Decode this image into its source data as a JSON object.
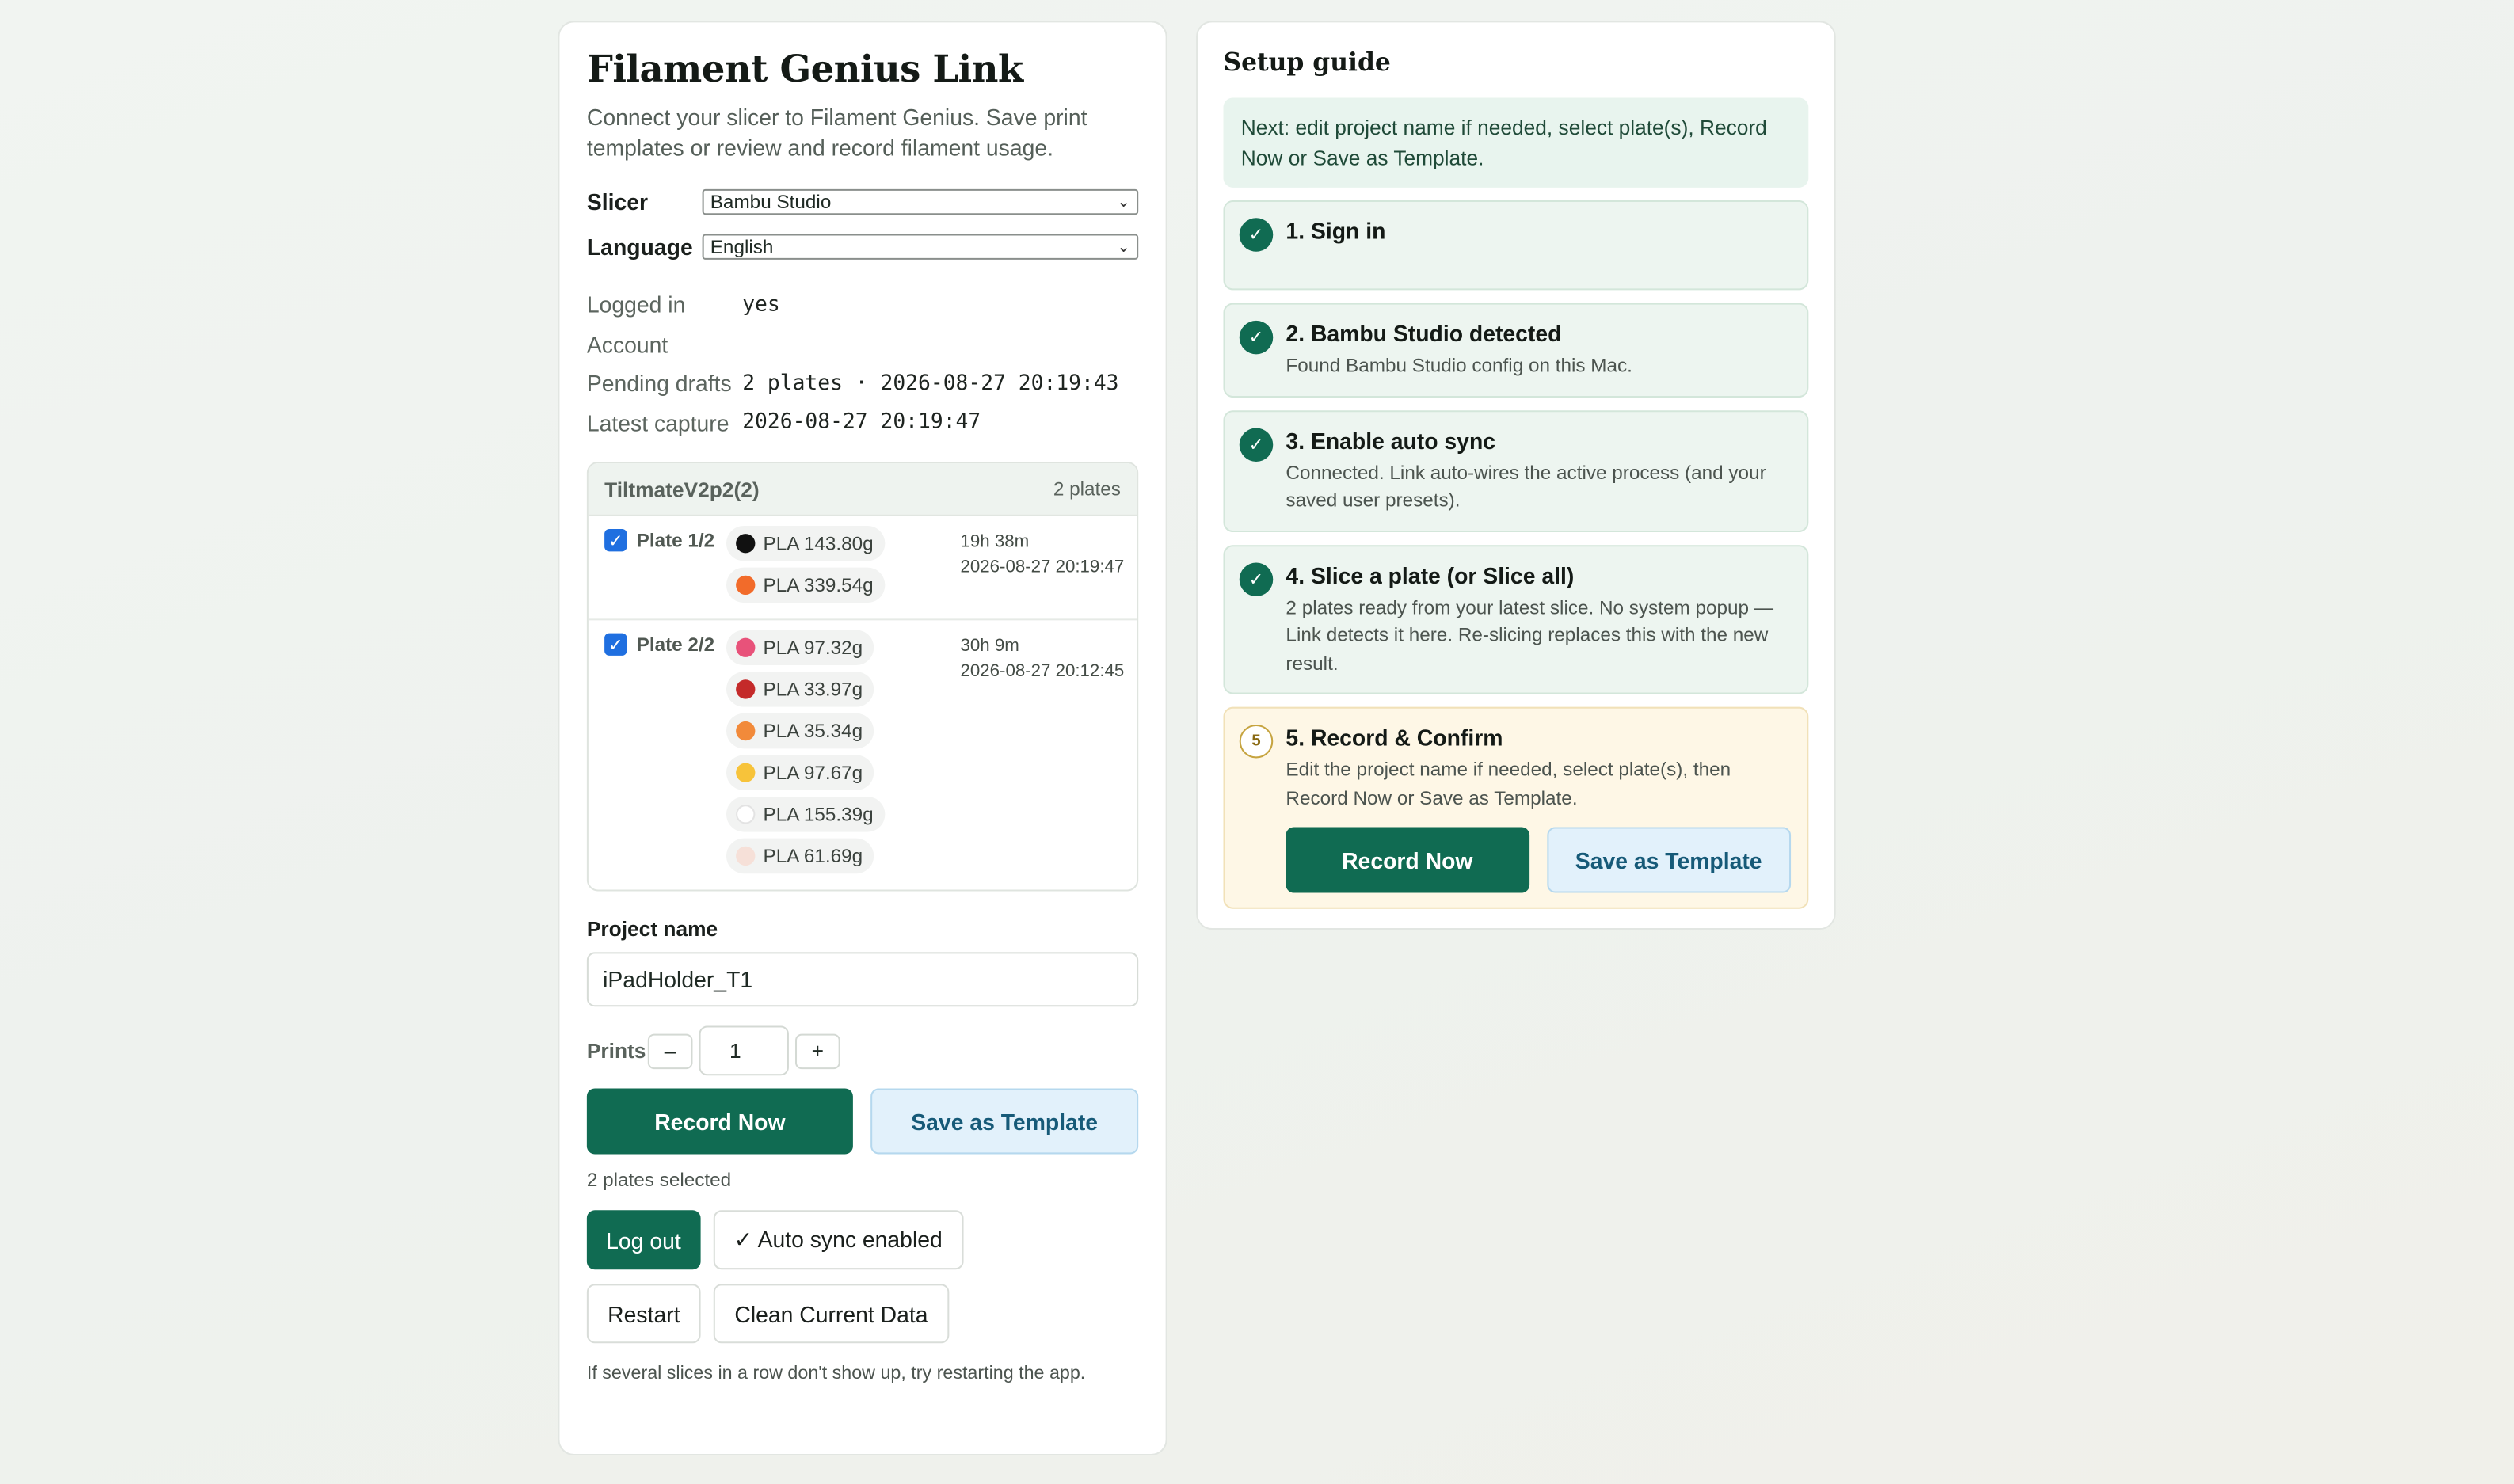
{
  "app": {
    "title": "Filament Genius Link",
    "subtitle": "Connect your slicer to Filament Genius. Save print templates or review and record filament usage."
  },
  "settings": {
    "slicer_label": "Slicer",
    "slicer_value": "Bambu Studio",
    "language_label": "Language",
    "language_value": "English"
  },
  "status": {
    "logged_in_label": "Logged in",
    "logged_in_value": "yes",
    "account_label": "Account",
    "account_value": "",
    "pending_label": "Pending drafts",
    "pending_value": "2 plates · 2026-08-27 20:19:43",
    "latest_label": "Latest capture",
    "latest_value": "2026-08-27 20:19:47"
  },
  "project": {
    "name": "TiltmateV2p2(2)",
    "plate_count": "2 plates",
    "plates": [
      {
        "label": "Plate 1/2",
        "checked": true,
        "time": "19h 38m",
        "date": "2026-08-27 20:19:47",
        "filaments": [
          {
            "label": "PLA 143.80g",
            "color": "#111111"
          },
          {
            "label": "PLA 339.54g",
            "color": "#f26b2a"
          }
        ]
      },
      {
        "label": "Plate 2/2",
        "checked": true,
        "time": "30h 9m",
        "date": "2026-08-27 20:12:45",
        "filaments": [
          {
            "label": "PLA 97.32g",
            "color": "#e8527a"
          },
          {
            "label": "PLA 33.97g",
            "color": "#c42a2a"
          },
          {
            "label": "PLA 35.34g",
            "color": "#f28a3a"
          },
          {
            "label": "PLA 97.67g",
            "color": "#f7c33a"
          },
          {
            "label": "PLA 155.39g",
            "color": "#ffffff"
          },
          {
            "label": "PLA 61.69g",
            "color": "#f6e0d8"
          }
        ]
      }
    ]
  },
  "form": {
    "project_name_label": "Project name",
    "project_name_value": "iPadHolder_T1",
    "prints_label": "Prints",
    "prints_value": "1",
    "minus": "–",
    "plus": "+",
    "record_now": "Record Now",
    "save_template": "Save as Template",
    "selected_note": "2 plates selected"
  },
  "actions": {
    "logout": "Log out",
    "auto_sync": "✓ Auto sync enabled",
    "restart": "Restart",
    "clean": "Clean Current Data",
    "footnote": "If several slices in a row don't show up, try restarting the app."
  },
  "guide": {
    "title": "Setup guide",
    "next": "Next: edit project name if needed, select plate(s), Record Now or Save as Template.",
    "steps": [
      {
        "title": "1. Sign in",
        "desc": "",
        "icon": "✓"
      },
      {
        "title": "2. Bambu Studio detected",
        "desc": "Found Bambu Studio config on this Mac.",
        "icon": "✓"
      },
      {
        "title": "3. Enable auto sync",
        "desc": "Connected. Link auto-wires the active process (and your saved user presets).",
        "icon": "✓"
      },
      {
        "title": "4. Slice a plate (or Slice all)",
        "desc": "2 plates ready from your latest slice. No system popup — Link detects it here. Re-slicing replaces this with the new result.",
        "icon": "✓"
      },
      {
        "title": "5. Record & Confirm",
        "desc": "Edit the project name if needed, select plate(s), then Record Now or Save as Template.",
        "icon": "5"
      }
    ],
    "record_now": "Record Now",
    "save_template": "Save as Template"
  },
  "colors": {
    "accent": "#106b52",
    "checkbox": "#1f6fe0",
    "secondary_bg": "#e2f1fb"
  }
}
